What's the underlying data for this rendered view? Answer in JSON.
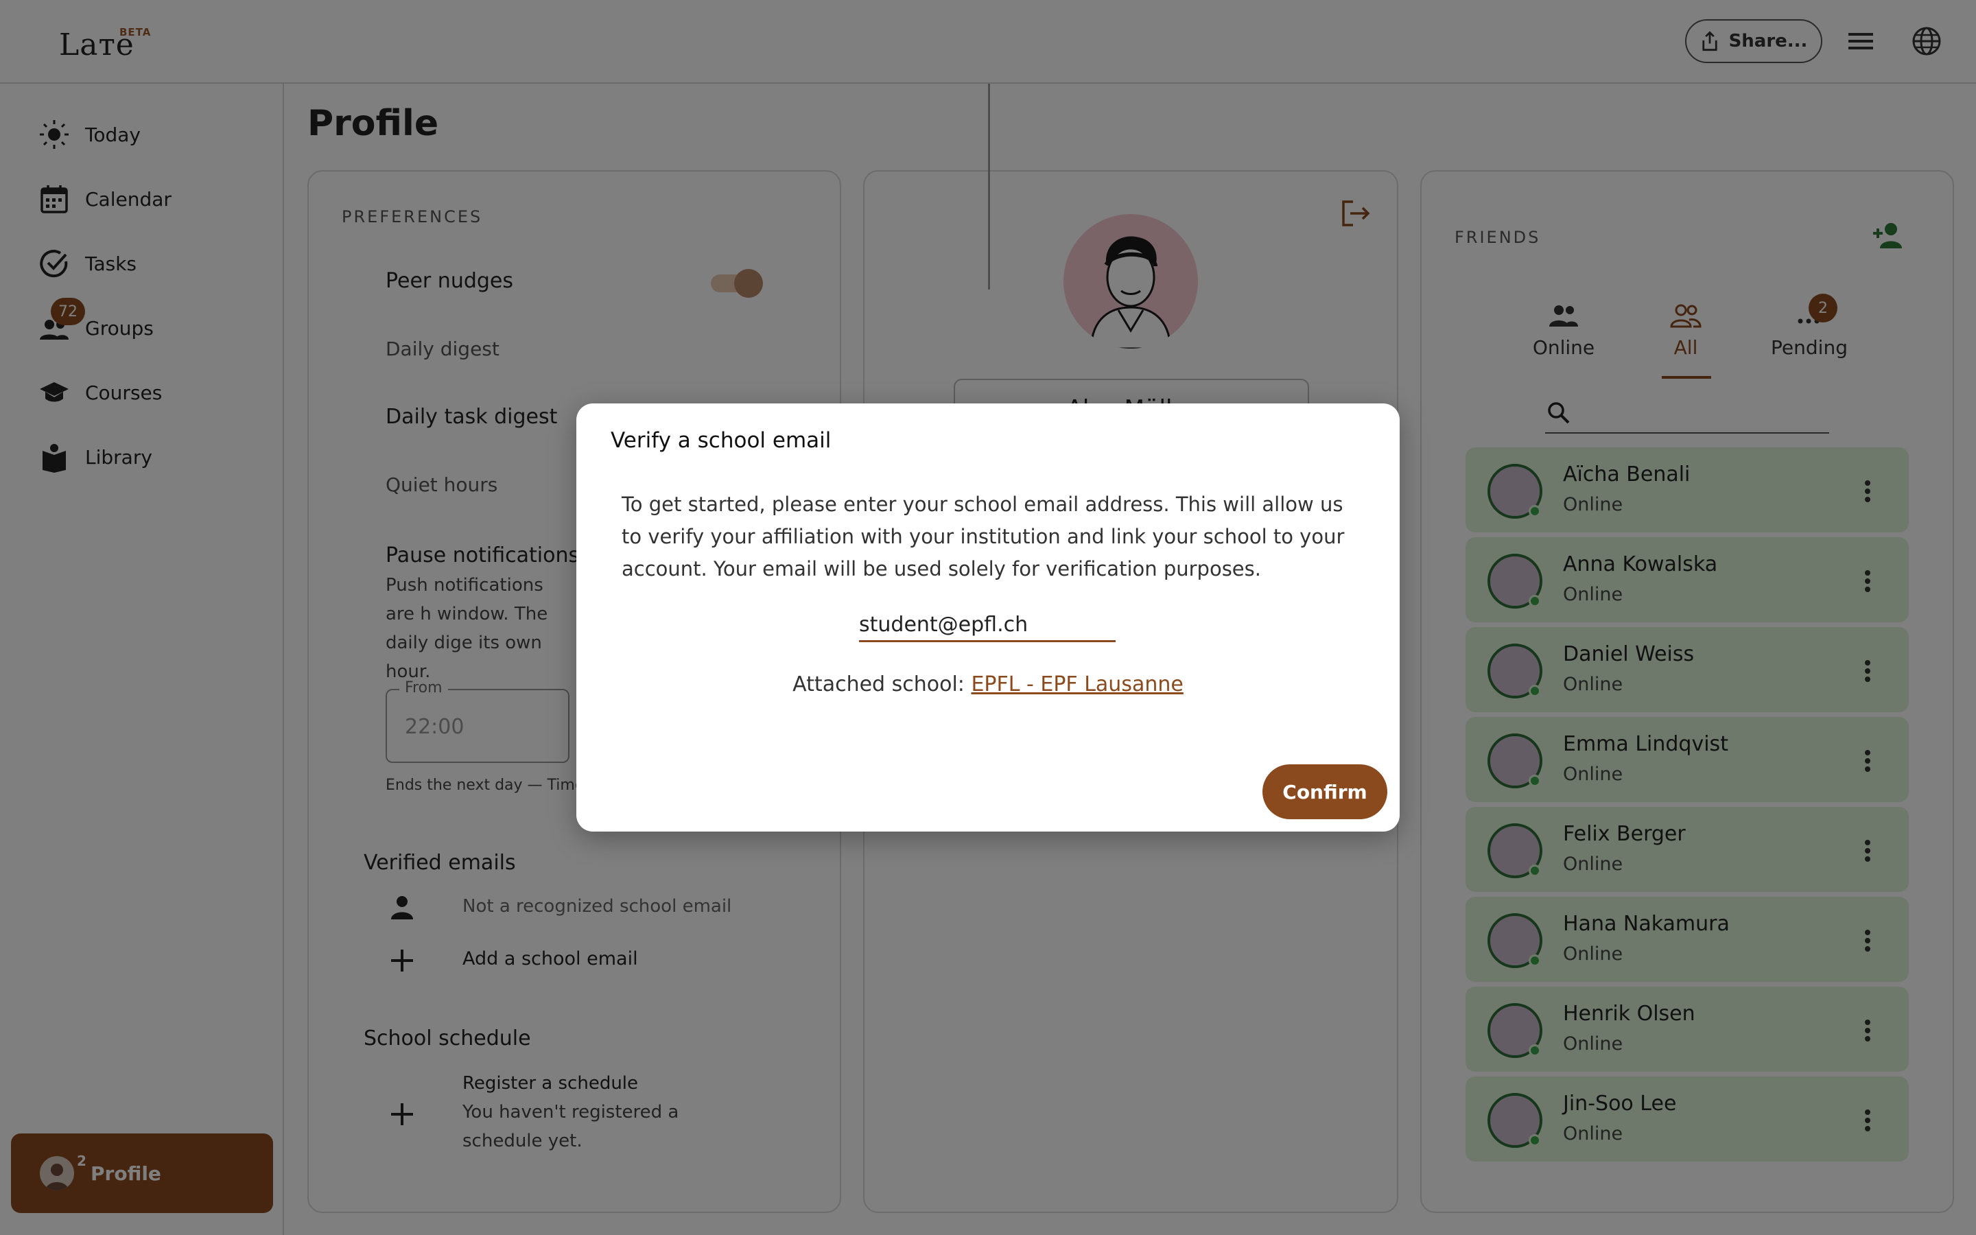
{
  "app": {
    "logo_text": "Laтe",
    "beta_label": "BETA",
    "share_label": "Share..."
  },
  "sidebar": {
    "items": [
      {
        "label": "Today",
        "icon": "sun-icon"
      },
      {
        "label": "Calendar",
        "icon": "calendar-icon"
      },
      {
        "label": "Tasks",
        "icon": "check-circle-icon"
      },
      {
        "label": "Groups",
        "icon": "group-icon",
        "badge": "72"
      },
      {
        "label": "Courses",
        "icon": "graduation-cap-icon"
      },
      {
        "label": "Library",
        "icon": "book-icon"
      }
    ],
    "profile": {
      "label": "Profile",
      "badge": "2"
    }
  },
  "page": {
    "title": "Profile"
  },
  "preferences": {
    "section_label": "PREFERENCES",
    "peer_nudges": "Peer nudges",
    "daily_digest": "Daily digest",
    "daily_task_digest": "Daily task digest",
    "quiet_hours": "Quiet hours",
    "pause_title": "Pause notifications o",
    "pause_desc": "Push notifications are h window. The daily dige its own hour.",
    "from_label": "From",
    "from_value": "22:00",
    "ends_note": "Ends the next day — Time",
    "verified_emails": "Verified emails",
    "not_recognized": "Not a recognized school email",
    "add_school_email": "Add a school email",
    "school_schedule": "School schedule",
    "register_schedule": "Register a schedule",
    "no_schedule": "You haven't registered a schedule yet."
  },
  "profile_card": {
    "name": "Alex Müller"
  },
  "friends": {
    "section_label": "FRIENDS",
    "tabs": [
      {
        "label": "Online"
      },
      {
        "label": "All"
      },
      {
        "label": "Pending",
        "badge": "2"
      }
    ],
    "list": [
      {
        "name": "Aïcha Benali",
        "status": "Online"
      },
      {
        "name": "Anna Kowalska",
        "status": "Online"
      },
      {
        "name": "Daniel Weiss",
        "status": "Online"
      },
      {
        "name": "Emma Lindqvist",
        "status": "Online"
      },
      {
        "name": "Felix Berger",
        "status": "Online"
      },
      {
        "name": "Hana Nakamura",
        "status": "Online"
      },
      {
        "name": "Henrik Olsen",
        "status": "Online"
      },
      {
        "name": "Jin-Soo Lee",
        "status": "Online"
      }
    ]
  },
  "modal": {
    "title": "Verify a school email",
    "body": "To get started, please enter your school email address. This will allow us to verify your affiliation with your institution and link your school to your account. Your email will be used solely for verification purposes.",
    "email_value": "student@epfl.ch",
    "attached_prefix": "Attached school: ",
    "attached_school": "EPFL - EPF Lausanne",
    "confirm_label": "Confirm"
  },
  "colors": {
    "accent": "#8a4a1e",
    "friend_bg": "#ddf3d8",
    "online_dot": "#3aa54a"
  }
}
